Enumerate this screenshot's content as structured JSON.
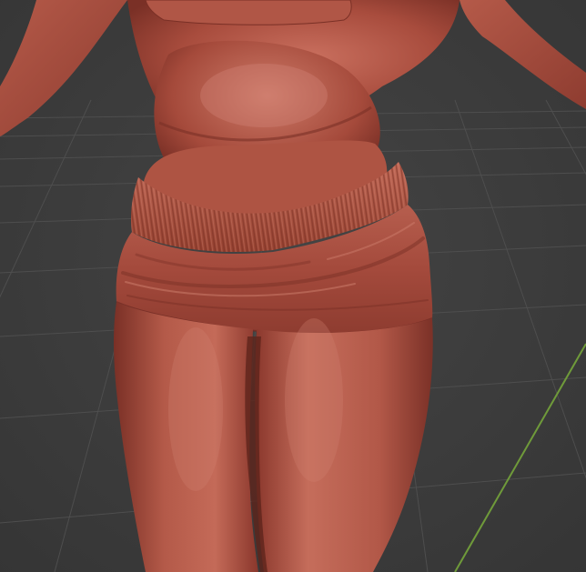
{
  "viewport": {
    "background_color": "#3d3d3d",
    "grid_line_color": "#4f4f4f",
    "y_axis_color": "#6f9a3a",
    "sculpt_base_color": "#a44a3c",
    "sculpt_highlight_color": "#cf7a68",
    "sculpt_shadow_color": "#6e2a22",
    "subject": "3d-sculpt-torso-skirt-legs"
  }
}
